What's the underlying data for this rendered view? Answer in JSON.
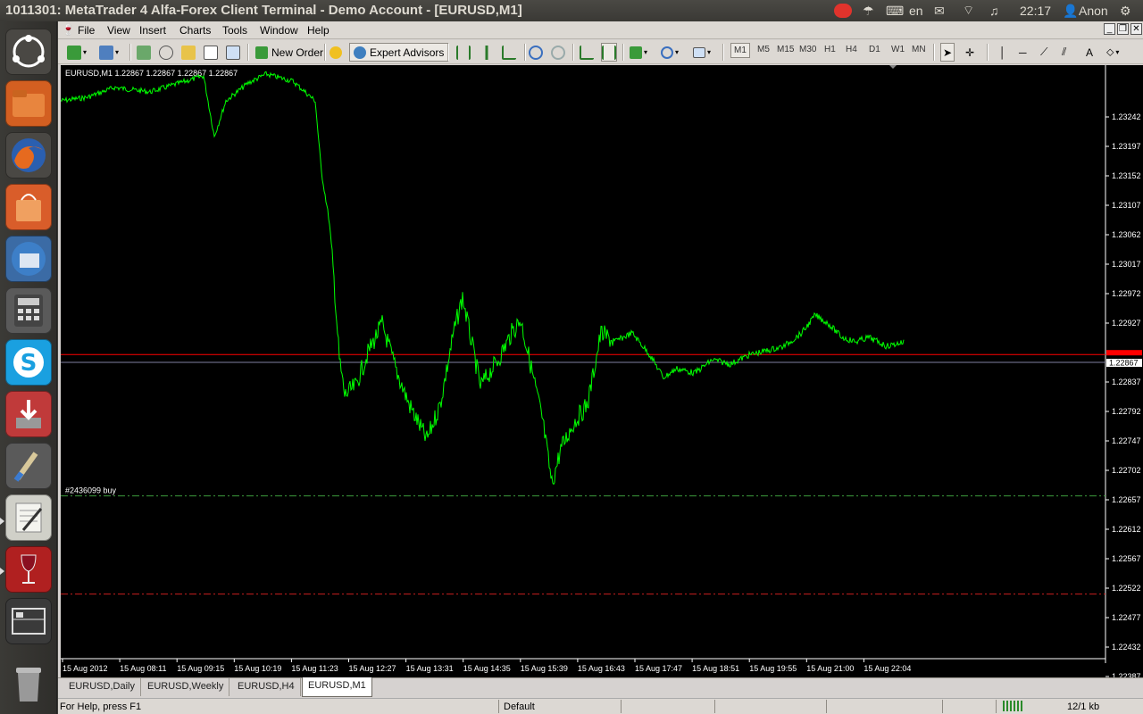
{
  "top_panel": {
    "window_title": "1011301: MetaTrader 4 Alfa-Forex Client Terminal - Demo Account - [EURUSD,M1]",
    "keyboard_layout": "en",
    "clock": "22:17",
    "user": "Anon"
  },
  "menu": {
    "file": "File",
    "view": "View",
    "insert": "Insert",
    "charts": "Charts",
    "tools": "Tools",
    "window": "Window",
    "help": "Help"
  },
  "toolbar": {
    "new_order": "New Order",
    "expert_advisors": "Expert Advisors",
    "timeframes": [
      "M1",
      "M5",
      "M15",
      "M30",
      "H1",
      "H4",
      "D1",
      "W1",
      "MN"
    ],
    "active_timeframe": "M1"
  },
  "chart": {
    "header": "EURUSD,M1  1.22867 1.22867 1.22867 1.22867",
    "order_label": "#2436099 buy",
    "current_price_label": "1.22867",
    "price_ticks": [
      "1.23242",
      "1.23197",
      "1.23152",
      "1.23107",
      "1.23062",
      "1.23017",
      "1.22972",
      "1.22927",
      "1.22837",
      "1.22792",
      "1.22747",
      "1.22702",
      "1.22657",
      "1.22612",
      "1.22567",
      "1.22522",
      "1.22477",
      "1.22432",
      "1.22387"
    ],
    "time_ticks": [
      "15 Aug 2012",
      "15 Aug 08:11",
      "15 Aug 09:15",
      "15 Aug 10:19",
      "15 Aug 11:23",
      "15 Aug 12:27",
      "15 Aug 13:31",
      "15 Aug 14:35",
      "15 Aug 15:39",
      "15 Aug 16:43",
      "15 Aug 17:47",
      "15 Aug 18:51",
      "15 Aug 19:55",
      "15 Aug 21:00",
      "15 Aug 22:04"
    ],
    "colors": {
      "background": "#000000",
      "line": "#00ff00",
      "ask_line": "#ff0000",
      "bid_line": "#8080a0",
      "order_line": "#3c9a3c",
      "stoploss_line": "#c81e1e"
    }
  },
  "tabs": [
    "EURUSD,Daily",
    "EURUSD,Weekly",
    "EURUSD,H4",
    "EURUSD,M1"
  ],
  "active_tab": "EURUSD,M1",
  "status": {
    "help": "For Help, press F1",
    "profile": "Default",
    "traffic": "12/1 kb"
  }
}
